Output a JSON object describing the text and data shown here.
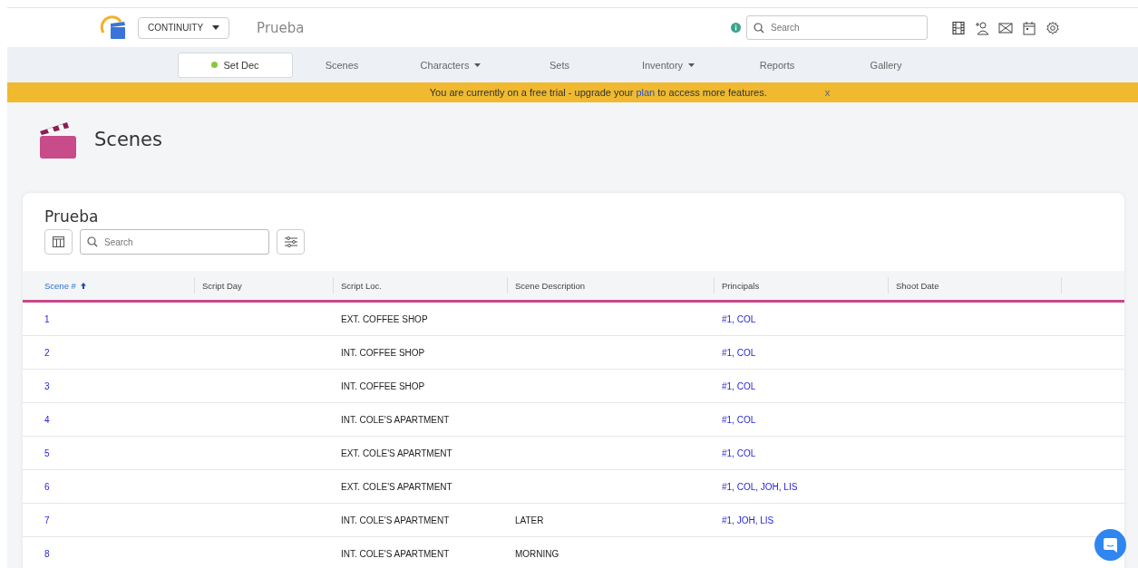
{
  "header": {
    "app_menu": "CONTINUITY",
    "project_title": "Prueba",
    "search": {
      "placeholder": "Search"
    }
  },
  "nav": {
    "tabs": [
      {
        "label": "Set Dec",
        "selected": true,
        "dropdown": false
      },
      {
        "label": "Scenes",
        "selected": false,
        "dropdown": false
      },
      {
        "label": "Characters",
        "selected": false,
        "dropdown": true
      },
      {
        "label": "Sets",
        "selected": false,
        "dropdown": false
      },
      {
        "label": "Inventory",
        "selected": false,
        "dropdown": true
      },
      {
        "label": "Reports",
        "selected": false,
        "dropdown": false
      },
      {
        "label": "Gallery",
        "selected": false,
        "dropdown": false
      }
    ]
  },
  "banner": {
    "text_before": "You are currently on a free trial - upgrade your ",
    "link": "plan",
    "text_after": " to access more features.",
    "close": "x"
  },
  "page": {
    "title": "Scenes"
  },
  "card": {
    "title": "Prueba",
    "search": {
      "placeholder": "Search"
    }
  },
  "table": {
    "columns": [
      {
        "label": "Scene #",
        "sorted": true
      },
      {
        "label": "Script Day",
        "sorted": false
      },
      {
        "label": "Script Loc.",
        "sorted": false
      },
      {
        "label": "Scene Description",
        "sorted": false
      },
      {
        "label": "Principals",
        "sorted": false
      },
      {
        "label": "Shoot Date",
        "sorted": false
      }
    ],
    "rows": [
      {
        "scene": "1",
        "script_loc": "EXT. COFFEE SHOP",
        "principals": "#1, COL"
      },
      {
        "scene": "2",
        "script_loc": "INT. COFFEE SHOP",
        "principals": "#1, COL"
      },
      {
        "scene": "3",
        "script_loc": "INT. COFFEE SHOP",
        "principals": "#1, COL"
      },
      {
        "scene": "4",
        "script_loc": "INT. COLE'S APARTMENT",
        "principals": "#1, COL"
      },
      {
        "scene": "5",
        "script_loc": "EXT. COLE'S APARTMENT",
        "principals": "#1, COL"
      },
      {
        "scene": "6",
        "script_loc": "EXT. COLE'S APARTMENT",
        "principals": "#1, COL, JOH, LIS"
      },
      {
        "scene": "7",
        "script_loc": "INT. COLE'S APARTMENT",
        "scene_description": "LATER",
        "principals": "#1, JOH, LIS"
      },
      {
        "scene": "8",
        "script_loc": "INT. COLE'S APARTMENT",
        "scene_description": "MORNING"
      }
    ]
  }
}
